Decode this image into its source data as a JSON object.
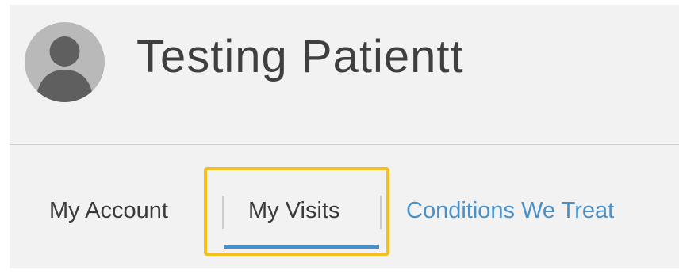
{
  "profile": {
    "name": "Testing Patientt",
    "avatar_icon": "user-silhouette-icon"
  },
  "nav": {
    "tabs": [
      {
        "label": "My Account",
        "active": false
      },
      {
        "label": "My Visits",
        "active": true
      },
      {
        "label": "Conditions We Treat",
        "active": false,
        "style": "link"
      }
    ]
  },
  "colors": {
    "background": "#f2f2f2",
    "name_text": "#3f3f3f",
    "tab_text": "#3a3a3a",
    "link_accent": "#4a90c8",
    "active_underline": "#4a90c8",
    "highlight_outline": "#f5be1f",
    "avatar_bg": "#b9b9b9"
  }
}
